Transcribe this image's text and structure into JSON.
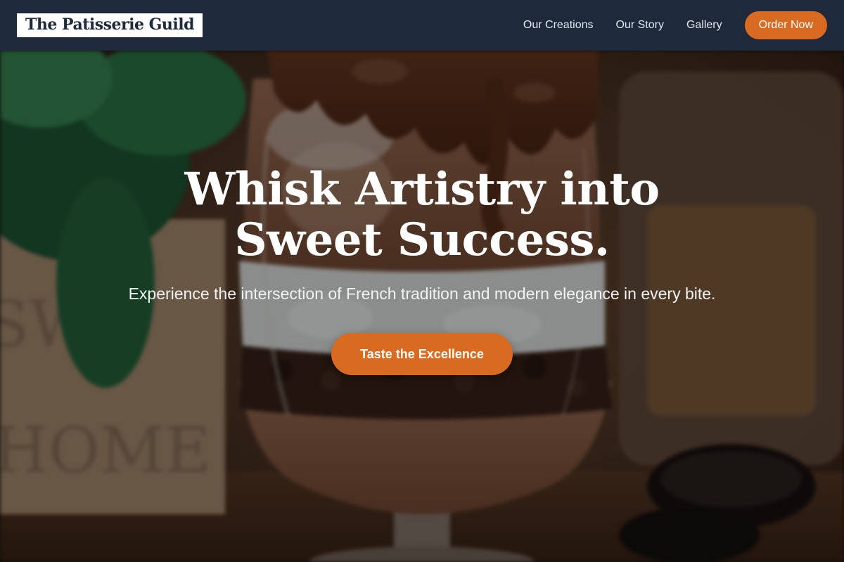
{
  "header": {
    "brand": "The Patisserie Guild",
    "nav": [
      {
        "label": "Our Creations"
      },
      {
        "label": "Our Story"
      },
      {
        "label": "Gallery"
      }
    ],
    "order_label": "Order Now"
  },
  "hero": {
    "title": "Whisk Artistry into Sweet Success.",
    "subtitle": "Experience the intersection of French tradition and modern elegance in every bite.",
    "cta_label": "Taste the Excellence",
    "background_description_icon": "dessert-photo"
  },
  "colors": {
    "nav_background": "#1e293b",
    "accent": "#d96a22",
    "text_light": "#ffffff"
  }
}
